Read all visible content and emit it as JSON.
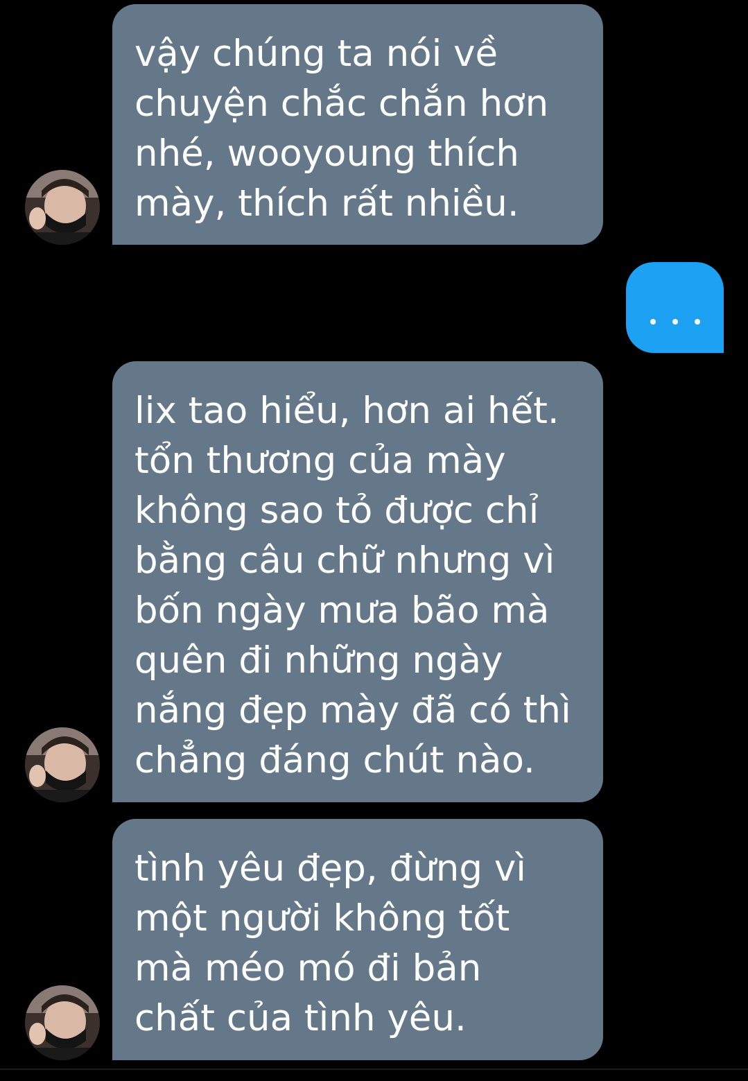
{
  "messages": [
    {
      "sender": "other",
      "text": "vậy chúng ta nói về\nchuyện chắc chắn hơn\nnhé, wooyoung thích\nmày, thích rất nhiều."
    },
    {
      "sender": "me",
      "text": "...",
      "typing_indicator": true
    },
    {
      "sender": "other",
      "text": "lix tao hiểu, hơn ai hết.\ntổn thương của mày\nkhông sao tỏ được chỉ\nbằng câu chữ nhưng vì\nbốn ngày mưa bão mà\nquên đi những ngày\nnắng đẹp mày đã có thì\nchẳng đáng chút nào."
    },
    {
      "sender": "other",
      "text": "tình yêu đẹp, đừng vì\nmột người không tốt\nmà méo mó đi bản\nchất của tình yêu."
    }
  ],
  "colors": {
    "background": "#000000",
    "incoming_bubble": "#65788a",
    "outgoing_bubble": "#1da1f2",
    "text": "#ffffff"
  }
}
